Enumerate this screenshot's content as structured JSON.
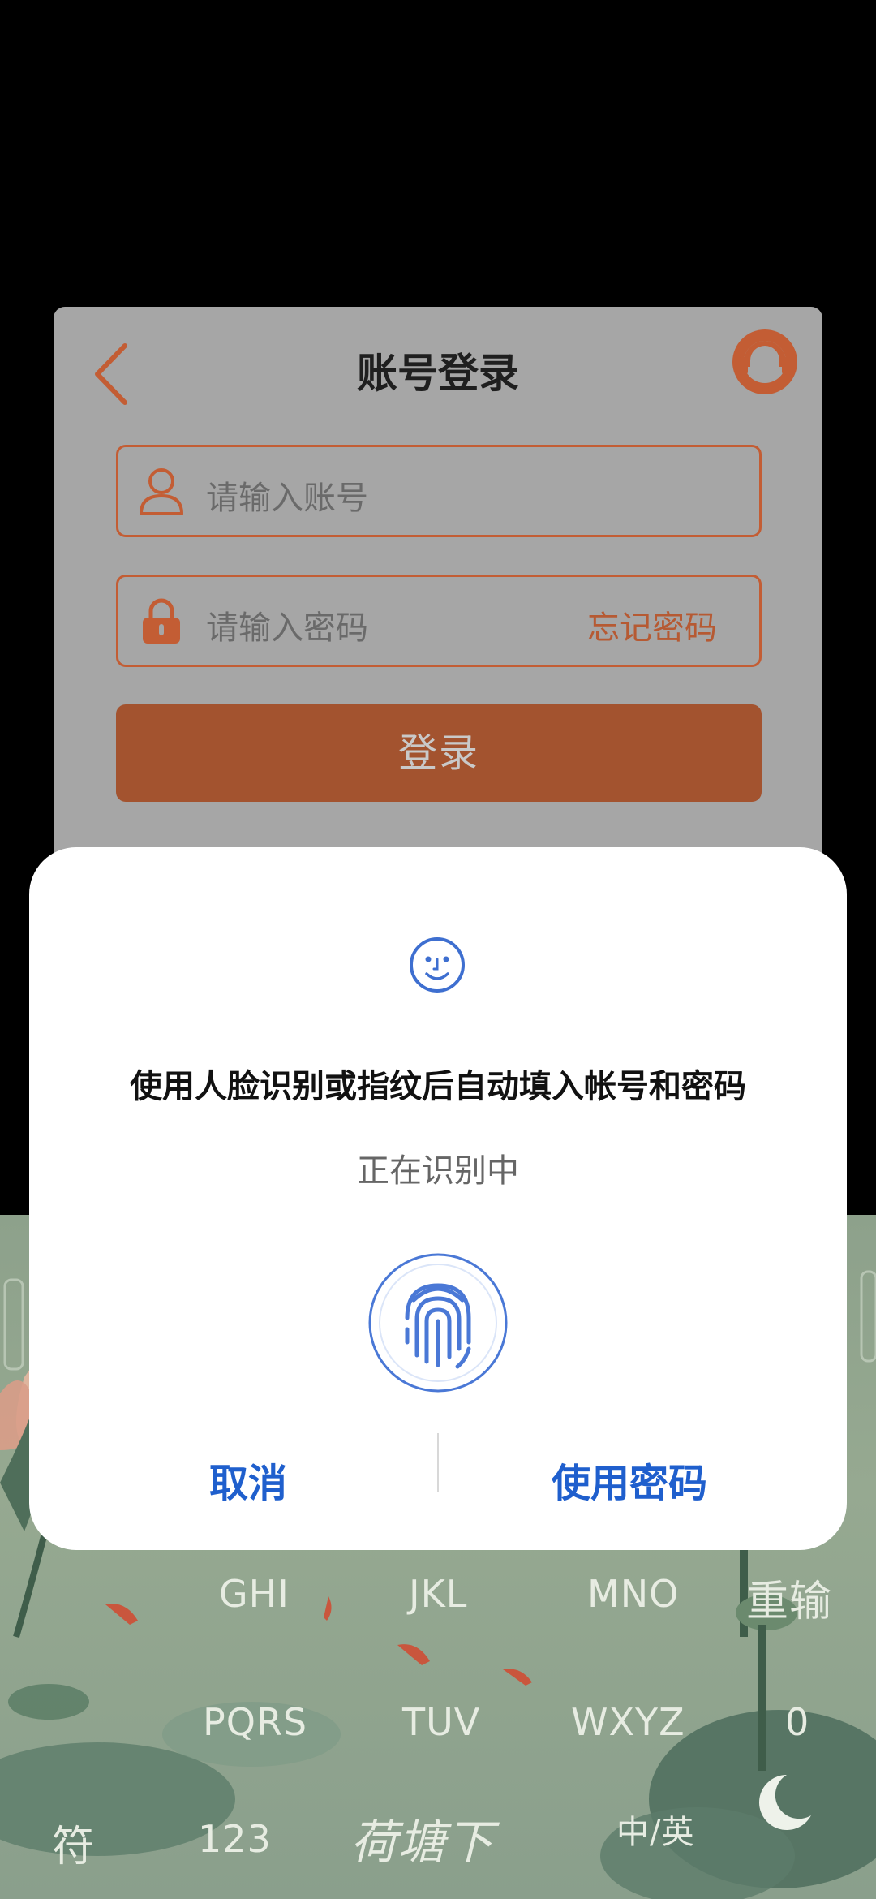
{
  "login": {
    "title": "账号登录",
    "account_placeholder": "请输入账号",
    "password_placeholder": "请输入密码",
    "forgot_label": "忘记密码",
    "login_label": "登录"
  },
  "dialog": {
    "message": "使用人脸识别或指纹后自动填入帐号和密码",
    "status": "正在识别中",
    "cancel_label": "取消",
    "use_password_label": "使用密码"
  },
  "keyboard": {
    "row1": [
      "GHI",
      "JKL",
      "MNO",
      "重输"
    ],
    "row2": [
      "PQRS",
      "TUV",
      "WXYZ",
      "0"
    ],
    "row3": [
      "符",
      "123",
      "荷塘下",
      "中/英"
    ]
  },
  "colors": {
    "accent": "#c35d34",
    "login_button": "#a3532f",
    "dialog_action": "#1f5fcd",
    "fingerprint": "#4a78d6"
  }
}
